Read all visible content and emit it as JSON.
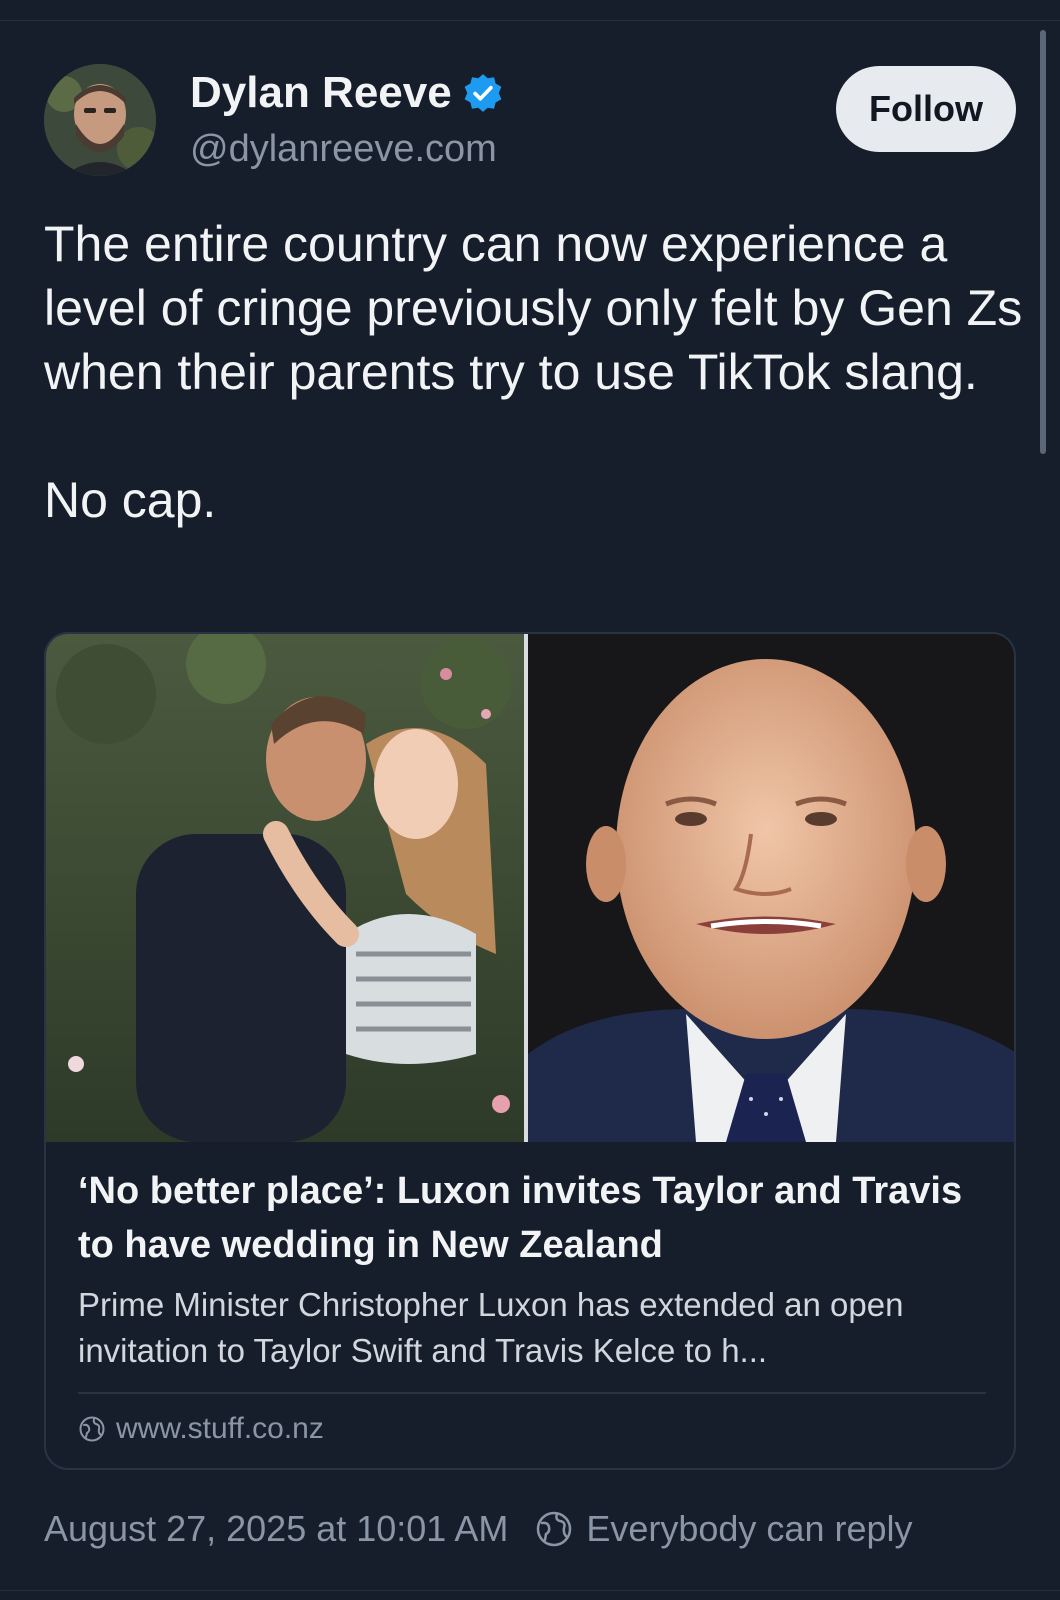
{
  "author": {
    "display_name": "Dylan Reeve",
    "handle": "@dylanreeve.com",
    "verified_icon": "verified-check-icon",
    "verified_color": "#1d9bf0"
  },
  "follow_button": {
    "label": "Follow"
  },
  "post": {
    "paragraphs": [
      "The entire country can now experience a level of cringe previously only felt by Gen Zs when their parents try to use TikTok slang.",
      "No cap."
    ]
  },
  "link_card": {
    "title": "‘No better place’: Luxon invites Taylor and Travis to have wedding in New Zealand",
    "description": "Prime Minister Christopher Luxon has extended an open invitation to Taylor Swift and Travis Kelce to h...",
    "source": "www.stuff.co.nz",
    "source_icon": "globe-icon"
  },
  "meta": {
    "timestamp": "August 27, 2025 at 10:01 AM",
    "reply_setting": "Everybody can reply",
    "reply_icon": "globe-icon"
  },
  "colors": {
    "background": "#161e2b",
    "text_primary": "#f1f3f5",
    "text_secondary": "#8a95a6",
    "follow_button_bg": "#e7eaee"
  }
}
